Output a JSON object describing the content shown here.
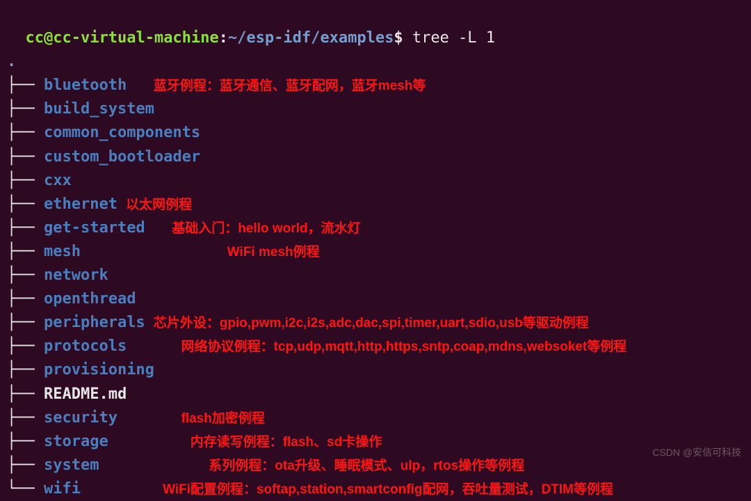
{
  "prompt": {
    "user_host": "cc@cc-virtual-machine",
    "colon": ":",
    "path": "~/esp-idf/examples",
    "dollar": "$",
    "command": " tree -L 1"
  },
  "dot": ".",
  "branches": {
    "mid": "├── ",
    "last": "└── "
  },
  "rows": [
    {
      "branch": "mid",
      "name": "bluetooth",
      "type": "dir",
      "anno": "蓝牙例程：蓝牙通信、蓝牙配网，蓝牙mesh等",
      "anno_pad": "  "
    },
    {
      "branch": "mid",
      "name": "build_system",
      "type": "dir",
      "anno": "",
      "anno_pad": ""
    },
    {
      "branch": "mid",
      "name": "common_components",
      "type": "dir",
      "anno": "",
      "anno_pad": ""
    },
    {
      "branch": "mid",
      "name": "custom_bootloader",
      "type": "dir",
      "anno": "",
      "anno_pad": ""
    },
    {
      "branch": "mid",
      "name": "cxx",
      "type": "dir",
      "anno": "",
      "anno_pad": ""
    },
    {
      "branch": "mid",
      "name": "ethernet",
      "type": "dir",
      "anno": "以太网例程",
      "anno_pad": ""
    },
    {
      "branch": "mid",
      "name": "get-started",
      "type": "dir",
      "anno": "基础入门：hello world，流水灯",
      "anno_pad": "  "
    },
    {
      "branch": "mid",
      "name": "mesh",
      "type": "dir",
      "anno": "WiFi mesh例程",
      "anno_pad": "               "
    },
    {
      "branch": "mid",
      "name": "network",
      "type": "dir",
      "anno": "",
      "anno_pad": ""
    },
    {
      "branch": "mid",
      "name": "openthread",
      "type": "dir",
      "anno": "",
      "anno_pad": ""
    },
    {
      "branch": "mid",
      "name": "peripherals",
      "type": "dir",
      "anno": "芯片外设：gpio,pwm,i2c,i2s,adc,dac,spi,timer,uart,sdio,usb等驱动例程",
      "anno_pad": ""
    },
    {
      "branch": "mid",
      "name": "protocols",
      "type": "dir",
      "anno": "网络协议例程：tcp,udp,mqtt,http,https,sntp,coap,mdns,websoket等例程",
      "anno_pad": "     "
    },
    {
      "branch": "mid",
      "name": "provisioning",
      "type": "dir",
      "anno": "",
      "anno_pad": ""
    },
    {
      "branch": "mid",
      "name": "README.md",
      "type": "file",
      "anno": "",
      "anno_pad": ""
    },
    {
      "branch": "mid",
      "name": "security",
      "type": "dir",
      "anno": "flash加密例程",
      "anno_pad": "      "
    },
    {
      "branch": "mid",
      "name": "storage",
      "type": "dir",
      "anno": "内存读写例程：flash、sd卡操作",
      "anno_pad": "        "
    },
    {
      "branch": "mid",
      "name": "system",
      "type": "dir",
      "anno": "系列例程：ota升级、睡眠模式、ulp，rtos操作等例程",
      "anno_pad": "           "
    },
    {
      "branch": "last",
      "name": "wifi",
      "type": "dir",
      "anno": "WiFi配置例程：softap,station,smartconfig配网，吞吐量测试，DTIM等例程",
      "anno_pad": "        "
    }
  ],
  "watermark": "CSDN @安信可科技"
}
